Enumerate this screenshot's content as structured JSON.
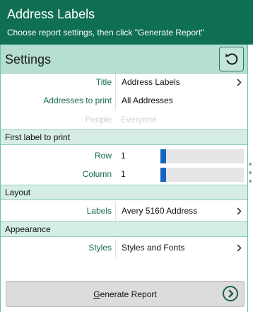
{
  "header": {
    "title": "Address Labels",
    "subtitle": "Choose report settings, then click \"Generate Report\""
  },
  "settings": {
    "title": "Settings",
    "reset_icon": "reset-icon"
  },
  "fields": {
    "title": {
      "label": "Title",
      "value": "Address Labels"
    },
    "addresses": {
      "label": "Addresses to print",
      "value": "All Addresses"
    },
    "people": {
      "label": "People",
      "value": "Everyone"
    }
  },
  "first_label": {
    "section": "First label to print",
    "row": {
      "label": "Row",
      "value": "1"
    },
    "column": {
      "label": "Column",
      "value": "1"
    }
  },
  "layout": {
    "section": "Layout",
    "labels": {
      "label": "Labels",
      "value": "Avery 5160 Address"
    }
  },
  "appearance": {
    "section": "Appearance",
    "styles": {
      "label": "Styles",
      "value": "Styles and Fonts"
    }
  },
  "footer": {
    "generate_first_letter": "G",
    "generate_rest": "enerate Report"
  },
  "colors": {
    "header_bg": "#0f6f52",
    "settings_bg": "#b5ddd2",
    "section_bg": "#d5ede6",
    "label_text": "#14694f",
    "slider_thumb": "#1565c0"
  }
}
